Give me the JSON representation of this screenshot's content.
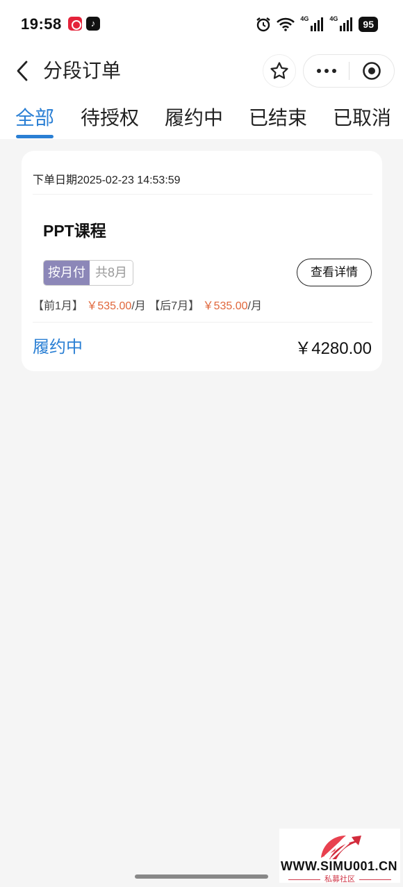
{
  "status_bar": {
    "time": "19:58",
    "battery": "95",
    "network_1": "4G",
    "network_2": "4G",
    "icons": [
      "xiaohongshu-app-icon",
      "tiktok-app-icon",
      "alarm-icon",
      "wifi-icon",
      "signal-icon",
      "signal-icon",
      "battery-icon"
    ]
  },
  "nav": {
    "title": "分段订单"
  },
  "tabs": [
    {
      "label": "全部",
      "active": true
    },
    {
      "label": "待授权",
      "active": false
    },
    {
      "label": "履约中",
      "active": false
    },
    {
      "label": "已结束",
      "active": false
    },
    {
      "label": "已取消",
      "active": false
    }
  ],
  "order": {
    "date": "下单日期2025-02-23 14:53:59",
    "product": "PPT课程",
    "pay_type": "按月付",
    "term": "共8月",
    "detail_button": "查看详情",
    "installment_1_label": "【前1月】",
    "installment_1_price": "￥535.00",
    "installment_1_unit": "/月",
    "installment_2_label": "【后7月】",
    "installment_2_price": "￥535.00",
    "installment_2_unit": "/月",
    "status": "履约中",
    "total": "￥4280.00"
  },
  "watermark": {
    "site": "WWW.SIMU001.CN",
    "caption": "私募社区"
  },
  "colors": {
    "accent": "#2a7fd4",
    "price": "#e0663a",
    "tag": "#8c87b8"
  }
}
